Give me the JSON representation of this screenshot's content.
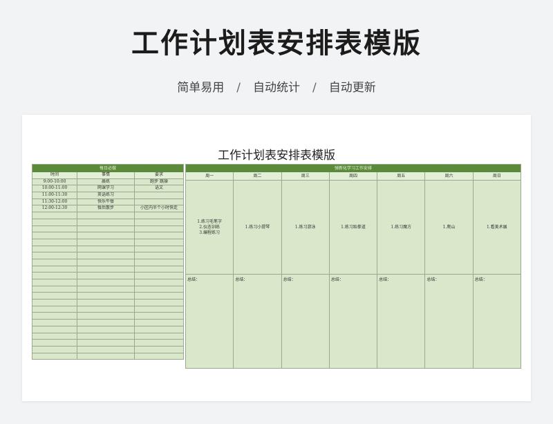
{
  "hero": {
    "title": "工作计划表安排表模版",
    "features": [
      "简单易用",
      "自动统计",
      "自动更新"
    ],
    "separator": "/"
  },
  "sheet": {
    "title": "工作计划表安排表模版",
    "daily": {
      "header": "每日必做",
      "columns": [
        "时间",
        "事情",
        "要求"
      ],
      "rows": [
        [
          "9:00-10:00",
          "晨练",
          "跑步 跳操"
        ],
        [
          "10:00-11:00",
          "网课学习",
          "语文"
        ],
        [
          "11:00-11:30",
          "英语练习",
          ""
        ],
        [
          "11:30-12:00",
          "快乐午餐",
          ""
        ],
        [
          "12:00-12:30",
          "餐后散步",
          "小区内半个小时快走"
        ],
        [
          "",
          "",
          ""
        ],
        [
          "",
          "",
          ""
        ],
        [
          "",
          "",
          ""
        ],
        [
          "",
          "",
          ""
        ],
        [
          "",
          "",
          ""
        ],
        [
          "",
          "",
          ""
        ],
        [
          "",
          "",
          ""
        ],
        [
          "",
          "",
          ""
        ],
        [
          "",
          "",
          ""
        ],
        [
          "",
          "",
          ""
        ],
        [
          "",
          "",
          ""
        ],
        [
          "",
          "",
          ""
        ],
        [
          "",
          "",
          ""
        ],
        [
          "",
          "",
          ""
        ],
        [
          "",
          "",
          ""
        ],
        [
          "",
          "",
          ""
        ],
        [
          "",
          "",
          ""
        ],
        [
          "",
          "",
          ""
        ],
        [
          "",
          "",
          ""
        ],
        [
          "",
          "",
          ""
        ],
        [
          "",
          "",
          ""
        ],
        [
          "",
          "",
          ""
        ]
      ]
    },
    "weekly": {
      "header": "弹新化学习工作安排",
      "days": [
        "周一",
        "周二",
        "周三",
        "周四",
        "周五",
        "周六",
        "周日"
      ],
      "plans": [
        [
          "1.练习毛笔字",
          "2.仪态训练",
          "3.编程练习"
        ],
        [
          "1.练习小提琴"
        ],
        [
          "1.练习游泳"
        ],
        [
          "1.练习跆拳道"
        ],
        [
          "1.练习魔方"
        ],
        [
          "1.爬山"
        ],
        [
          "1.看美术展"
        ]
      ],
      "summary_label": "总结："
    }
  }
}
